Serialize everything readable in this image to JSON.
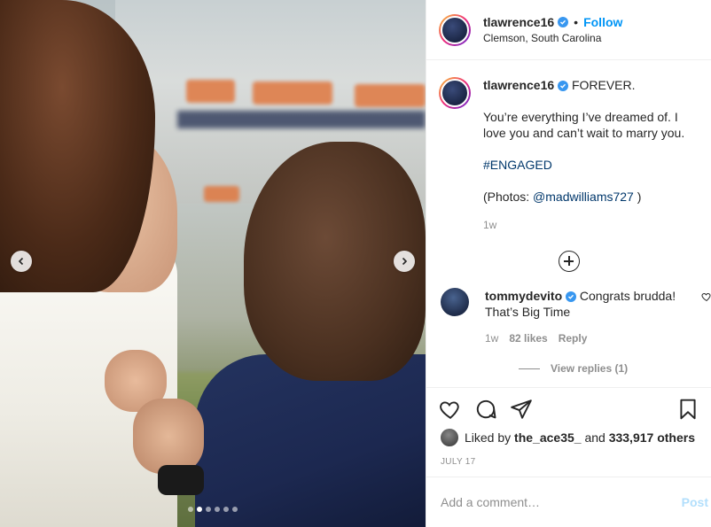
{
  "post": {
    "username": "tlawrence16",
    "follow_label": "Follow",
    "bullet": "•",
    "location": "Clemson, South Carolina"
  },
  "caption": {
    "username": "tlawrence16",
    "headline": "FOREVER.",
    "line1": "You’re everything I’ve dreamed of. I love you and can’t wait to marry you.",
    "hashtag": "#ENGAGED",
    "photos_prefix": "(Photos: ",
    "photos_mention": "@madwilliams727",
    "photos_suffix": " )",
    "time": "1w"
  },
  "comment": {
    "username": "tommydevito",
    "text": "Congrats brudda! That’s Big Time",
    "time": "1w",
    "likes": "82 likes",
    "reply_label": "Reply",
    "view_replies": "View replies (1)"
  },
  "likes": {
    "prefix": "Liked by ",
    "user": "the_ace35_",
    "middle": " and ",
    "others": "333,917 others"
  },
  "date": "JULY 17",
  "add_comment": {
    "placeholder": "Add a comment…",
    "post_label": "Post"
  },
  "carousel": {
    "dot_count": 6,
    "active_index": 1
  },
  "colors": {
    "link_blue": "#0095f6",
    "verified_blue": "#3897f0",
    "hashtag": "#00376b",
    "muted": "#8e8e8e",
    "post_disabled": "#b2dffc"
  },
  "icons": {
    "prev": "chevron-left-icon",
    "next": "chevron-right-icon",
    "like": "heart-icon",
    "comment": "comment-icon",
    "share": "paper-plane-icon",
    "save": "bookmark-icon",
    "load_more": "plus-circle-icon"
  }
}
